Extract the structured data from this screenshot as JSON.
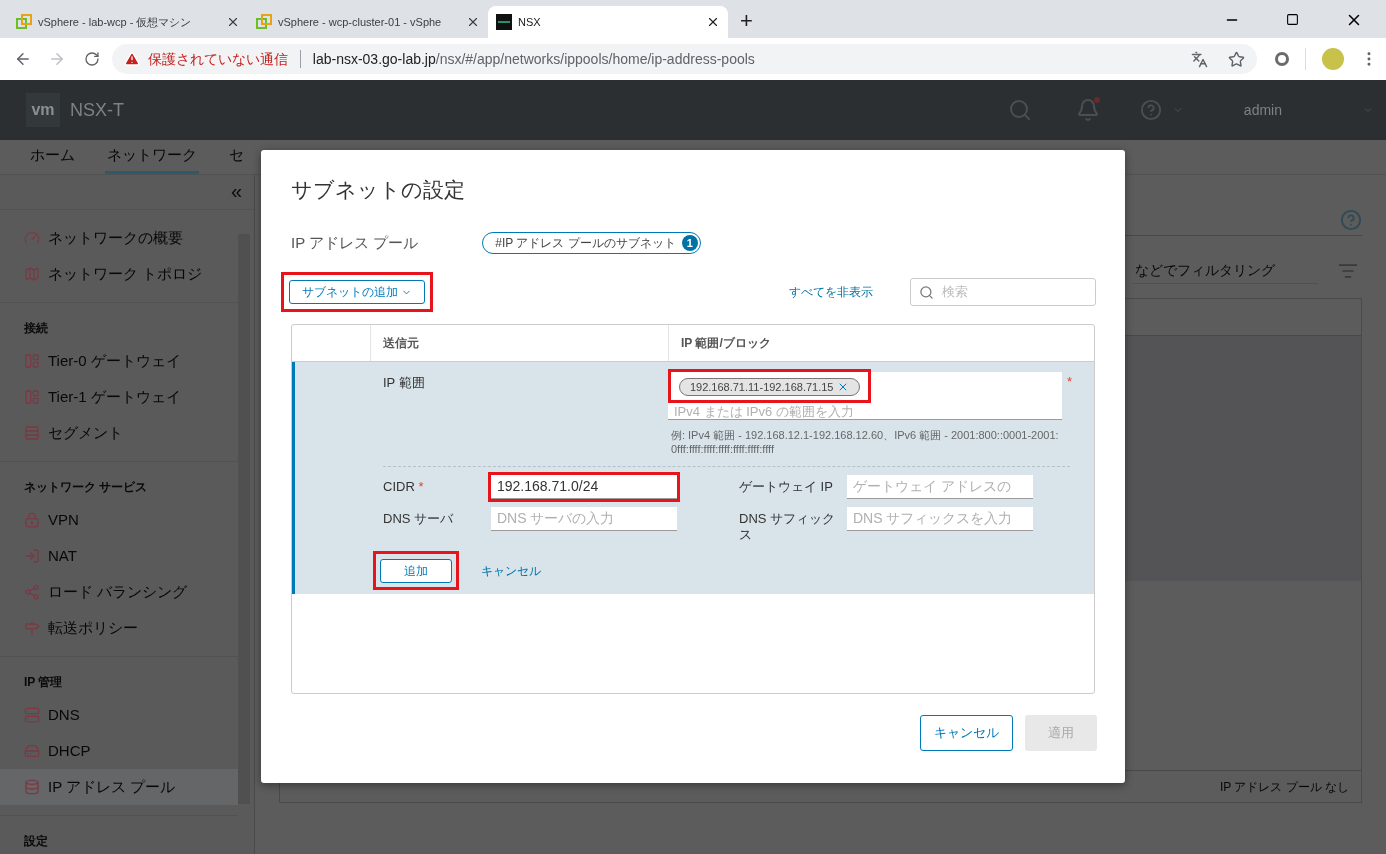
{
  "browser": {
    "tabs": [
      {
        "title": "vSphere - lab-wcp - 仮想マシン",
        "kind": "vsphere",
        "selected": false
      },
      {
        "title": "vSphere - wcp-cluster-01 - vSphe",
        "kind": "vsphere",
        "selected": false
      },
      {
        "title": "NSX",
        "kind": "nsx",
        "selected": true
      }
    ],
    "new_tab": "+",
    "security_warning": "保護されていない通信",
    "url_host": "lab-nsx-03.go-lab.jp",
    "url_path": "/nsx/#/app/networks/ippools/home/ip-address-pools"
  },
  "header": {
    "logo": "vm",
    "product": "NSX-T",
    "user": "admin"
  },
  "nav_tabs": [
    {
      "label": "ホーム",
      "selected": false
    },
    {
      "label": "ネットワーク",
      "selected": true
    },
    {
      "label": "セ",
      "selected": false
    }
  ],
  "sidebar": {
    "collapse": "«",
    "groups": [
      {
        "items": [
          {
            "label": "ネットワークの概要",
            "kind": "gauge",
            "selected": false
          },
          {
            "label": "ネットワーク トポロジ",
            "kind": "topology",
            "selected": false
          }
        ]
      },
      {
        "heading": "接続",
        "items": [
          {
            "label": "Tier-0 ゲートウェイ",
            "kind": "gateway",
            "selected": false
          },
          {
            "label": "Tier-1 ゲートウェイ",
            "kind": "gateway",
            "selected": false
          },
          {
            "label": "セグメント",
            "kind": "segment",
            "selected": false
          }
        ]
      },
      {
        "heading": "ネットワーク サービス",
        "items": [
          {
            "label": "VPN",
            "kind": "vpn",
            "selected": false
          },
          {
            "label": "NAT",
            "kind": "nat",
            "selected": false
          },
          {
            "label": "ロード バランシング",
            "kind": "lb",
            "selected": false
          },
          {
            "label": "転送ポリシー",
            "kind": "forwarding",
            "selected": false
          }
        ]
      },
      {
        "heading": "IP 管理",
        "items": [
          {
            "label": "DNS",
            "kind": "dns",
            "selected": false
          },
          {
            "label": "DHCP",
            "kind": "dhcp",
            "selected": false
          },
          {
            "label": "IP アドレス プール",
            "kind": "pool",
            "selected": true
          }
        ]
      },
      {
        "heading": "設定"
      }
    ]
  },
  "main": {
    "filter_placeholder": "などでフィルタリング",
    "empty_text": "IP アドレス プール なし"
  },
  "dialog": {
    "title": "サブネットの設定",
    "pool_label": "IP アドレス プール",
    "pool_chip": "#IP アドレス プールのサブネット",
    "pool_count": "1",
    "add_subnet": {
      "label": "サブネットの追加",
      "highlighted": true
    },
    "hide_all": "すべてを非表示",
    "search_placeholder": "検索",
    "columns": [
      "送信元",
      "IP 範囲/ブロック"
    ],
    "form": {
      "ip_range_label": "IP 範囲",
      "ip_ranges": [
        {
          "value": "192.168.71.11-192.168.71.15",
          "highlighted": true
        }
      ],
      "ip_range_placeholder": "IPv4 または IPv6 の範囲を入力",
      "required_mark": "*",
      "hint": "例: IPv4 範囲 - 192.168.12.1-192.168.12.60、IPv6 範囲 - 2001:800::0001-2001:0fff:ffff:ffff:ffff:ffff:ffff:ffff",
      "fields": [
        {
          "label": "CIDR",
          "required_mark": "*",
          "value": "192.168.71.0/24",
          "highlighted": true
        },
        {
          "label": "ゲートウェイ IP",
          "placeholder": "ゲートウェイ アドレスの",
          "highlighted": false
        },
        {
          "label": "DNS サーバ",
          "placeholder": "DNS サーバの入力",
          "highlighted": false
        },
        {
          "label": "DNS サフィックス",
          "placeholder": "DNS サフィックスを入力",
          "highlighted": false
        }
      ],
      "add": {
        "label": "追加",
        "highlighted": true
      },
      "cancel": "キャンセル"
    },
    "buttons": [
      {
        "label": "キャンセル",
        "disabled": false
      },
      {
        "label": "適用",
        "disabled": true
      }
    ]
  }
}
